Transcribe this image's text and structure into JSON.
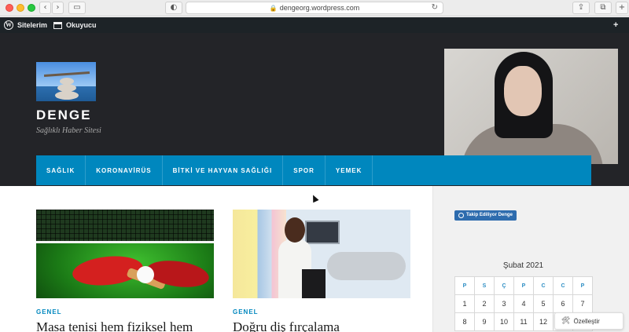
{
  "browser": {
    "url": "dengeorg.wordpress.com",
    "back_glyph": "‹",
    "forward_glyph": "›",
    "sidebar_glyph": "▭",
    "privacy_glyph": "◐",
    "share_glyph": "⇪",
    "tabs_glyph": "⧉",
    "newtab_glyph": "+"
  },
  "adminbar": {
    "my_sites": "Sitelerim",
    "reader": "Okuyucu",
    "notif_glyph": "+"
  },
  "site": {
    "title": "DENGE",
    "tagline": "Sağlıklı Haber Sitesi"
  },
  "nav": {
    "items": [
      "SAĞLIK",
      "KORONAVİRÜS",
      "BİTKİ VE HAYVAN SAĞLIĞI",
      "SPOR",
      "YEMEK"
    ]
  },
  "posts": [
    {
      "category": "GENEL",
      "title": "Masa tenisi hem fiziksel hem"
    },
    {
      "category": "GENEL",
      "title": "Doğru diş fırçalama"
    }
  ],
  "sidebar": {
    "follow_label": "Takip Ediliyor Denge",
    "calendar_title": "Şubat 2021",
    "weekdays": [
      "P",
      "S",
      "Ç",
      "P",
      "C",
      "C",
      "P"
    ],
    "weeks": [
      [
        "1",
        "2",
        "3",
        "4",
        "5",
        "6",
        "7"
      ],
      [
        "8",
        "9",
        "10",
        "11",
        "12",
        "",
        ""
      ]
    ]
  },
  "customize": {
    "label": "Özelleştir",
    "icon": "🛠"
  }
}
